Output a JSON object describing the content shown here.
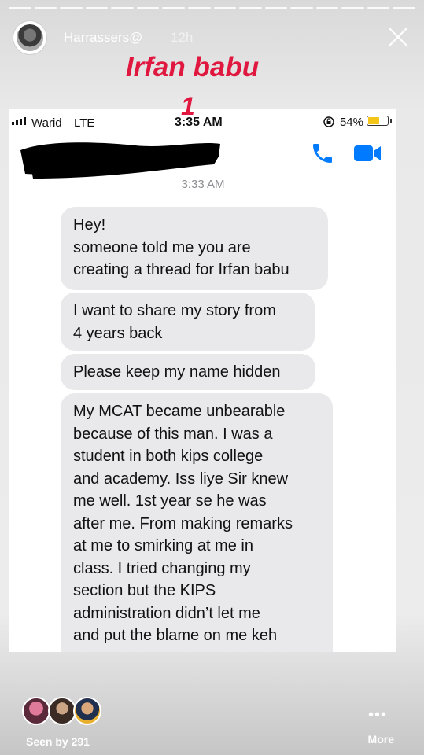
{
  "story": {
    "username": "Harrassers@",
    "time_ago": "12h",
    "overlay_title": "Irfan babu",
    "overlay_number": "1",
    "progress_segments": 16
  },
  "status_bar": {
    "carrier": "Warid",
    "network": "LTE",
    "time": "3:35 AM",
    "battery": "54%",
    "battery_level": 0.54
  },
  "conversation": {
    "timestamp": "3:33 AM",
    "messages": [
      {
        "lines": [
          "Hey!",
          "someone told me you are",
          "creating a thread for Irfan babu"
        ]
      },
      {
        "lines": [
          "I want to share my story from",
          "4 years back"
        ]
      },
      {
        "lines": [
          "Please keep my name hidden"
        ]
      },
      {
        "lines": [
          "My MCAT became unbearable",
          "because of this man. I was a",
          "student in both kips college",
          "and academy. Iss liye Sir knew",
          "me well. 1st year se he was",
          "after me. From making remarks",
          "at me to smirking at me in",
          "class. I tried changing my",
          "section but the KIPS",
          "administration didn’t let me",
          "and put the blame on me keh"
        ]
      }
    ]
  },
  "footer": {
    "seen_by": "Seen by 291",
    "more_label": "More",
    "more_dots": "•••"
  },
  "icons": {
    "close": "close-icon",
    "call": "phone-icon",
    "video": "video-camera-icon",
    "lock": "orientation-lock-icon"
  },
  "colors": {
    "overlay_text": "#e0183f",
    "ios_blue": "#007aff",
    "bubble_gray": "#e9e9eb",
    "battery_yellow": "#f5c518"
  }
}
